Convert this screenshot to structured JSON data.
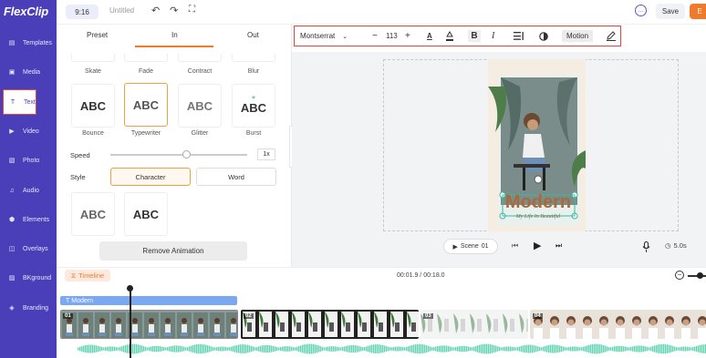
{
  "app": {
    "logo": "FlexClip"
  },
  "topbar": {
    "ratio": "9:16",
    "project_title": "Untitled",
    "save_label": "Save",
    "export_label": "E"
  },
  "sidebar": {
    "items": [
      {
        "label": "Templates",
        "icon": "layers-icon"
      },
      {
        "label": "Media",
        "icon": "folder-icon"
      },
      {
        "label": "Text",
        "icon": "text-icon",
        "active": true
      },
      {
        "label": "Video",
        "icon": "video-icon"
      },
      {
        "label": "Photo",
        "icon": "image-icon"
      },
      {
        "label": "Audio",
        "icon": "music-icon"
      },
      {
        "label": "Elements",
        "icon": "elements-icon"
      },
      {
        "label": "Overlays",
        "icon": "overlay-icon"
      },
      {
        "label": "BKground",
        "icon": "background-icon"
      },
      {
        "label": "Branding",
        "icon": "branding-icon"
      }
    ]
  },
  "panel": {
    "tabs": [
      "Preset",
      "In",
      "Out"
    ],
    "active_tab": "In",
    "top_row": [
      "Skate",
      "Fade",
      "Contract",
      "Blur"
    ],
    "animations": [
      {
        "label": "Bounce",
        "sample": "ABC"
      },
      {
        "label": "Typewriter",
        "sample": "ABC",
        "selected": true
      },
      {
        "label": "Glitter",
        "sample": "ABC"
      },
      {
        "label": "Burst",
        "sample": "ABC"
      }
    ],
    "speed_label": "Speed",
    "speed_value": "1x",
    "speed_level": 0.55,
    "style_label": "Style",
    "style_options": [
      "Character",
      "Word"
    ],
    "style_selected": "Character",
    "style_samples": [
      "ABC",
      "ABC"
    ],
    "remove_label": "Remove Animation"
  },
  "text_toolbar": {
    "font": "Montserrat",
    "size": "113",
    "bold": "B",
    "italic": "I",
    "motion_label": "Motion"
  },
  "canvas": {
    "headline": "Modern",
    "subline": "My Life In Beautiful",
    "scene_label": "Scene",
    "scene_number": "01",
    "duration": "5.0s"
  },
  "timeline": {
    "label": "Timeline",
    "time_current": "00:01.9",
    "time_total": "00:18.0",
    "text_track_label": "Modern",
    "clips": [
      "01",
      "02",
      "03",
      "04"
    ]
  },
  "colors": {
    "sidebar": "#4a3fb8",
    "accent": "#f07a2a",
    "highlight": "#e0463d",
    "text_track": "#7aa8f2",
    "wave": "#5fd3b0"
  }
}
